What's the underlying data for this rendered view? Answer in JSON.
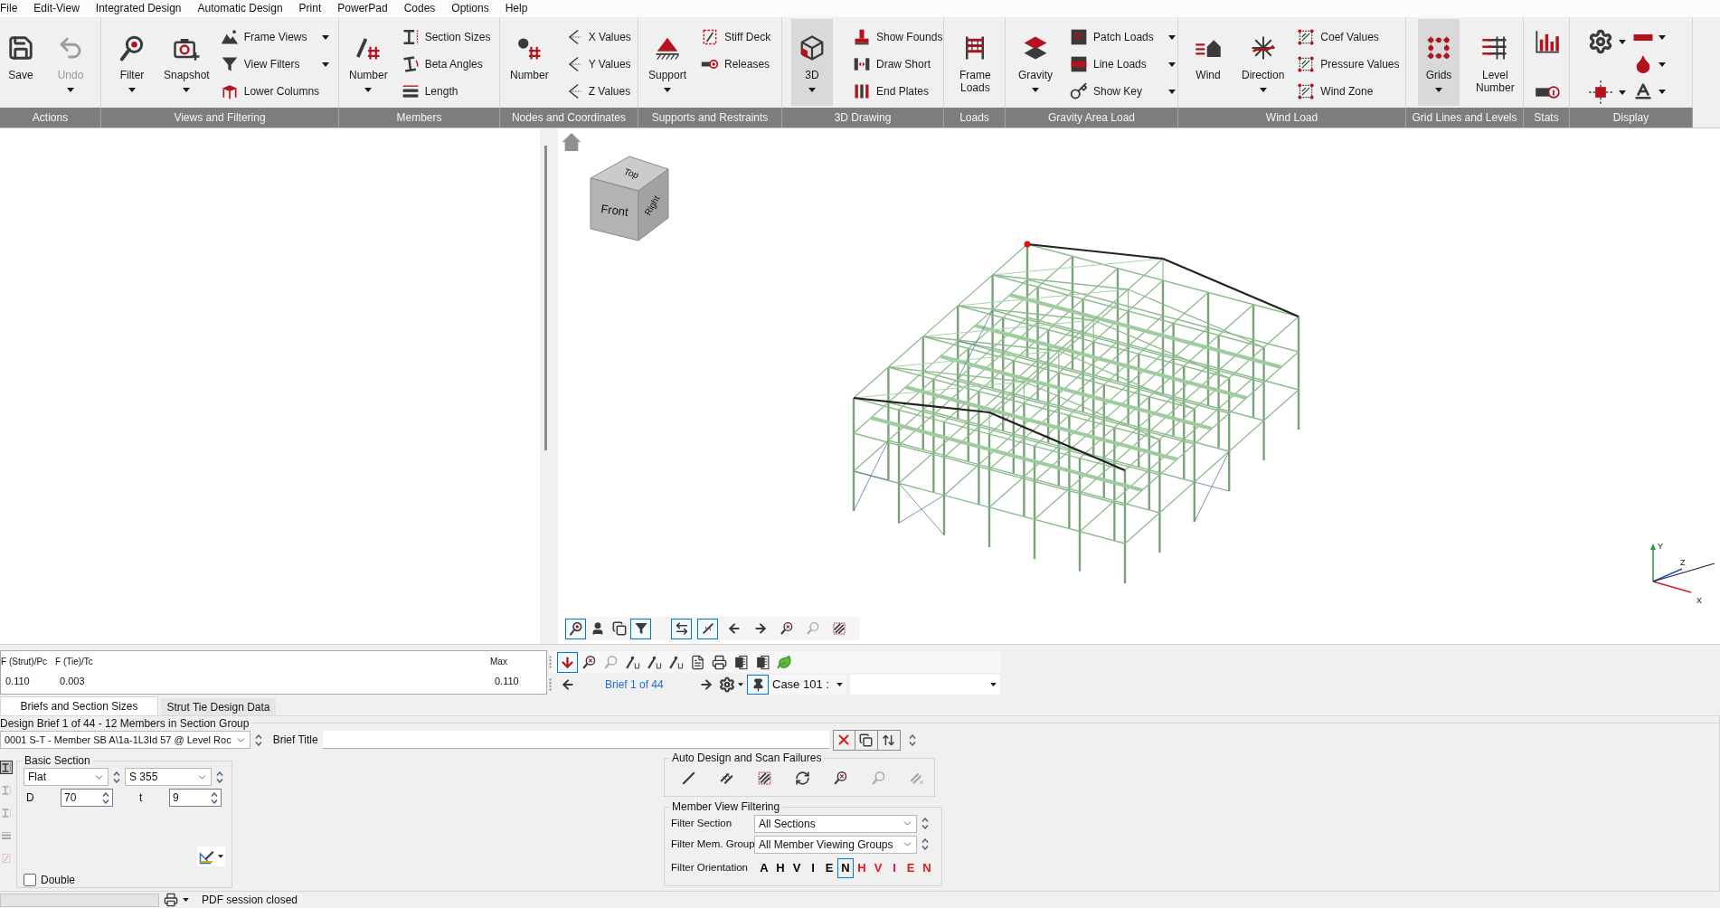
{
  "menu": [
    "File",
    "Edit-View",
    "Integrated Design",
    "Automatic Design",
    "Print",
    "PowerPad",
    "Codes",
    "Options",
    "Help"
  ],
  "ribbon": {
    "groups": [
      {
        "label": "Actions",
        "items": [
          {
            "kind": "large",
            "label": "Save",
            "dropdown": false,
            "selected": false,
            "disabled": false
          },
          {
            "kind": "large",
            "label": "Undo",
            "dropdown": true,
            "selected": false,
            "disabled": true
          }
        ]
      },
      {
        "label": "Views and Filtering",
        "items": [
          {
            "kind": "large",
            "label": "Filter",
            "dropdown": true,
            "selected": false,
            "disabled": false
          },
          {
            "kind": "large",
            "label": "Snapshot",
            "dropdown": true,
            "selected": false,
            "disabled": false
          },
          {
            "kind": "stack",
            "items": [
              {
                "label": "Frame Views",
                "dropdown": true
              },
              {
                "label": "View Filters",
                "dropdown": true
              },
              {
                "label": "Lower Columns",
                "dropdown": false
              }
            ]
          }
        ]
      },
      {
        "label": "Members",
        "items": [
          {
            "kind": "large",
            "label": "Number",
            "dropdown": true,
            "selected": false,
            "disabled": false
          },
          {
            "kind": "stack",
            "items": [
              {
                "label": "Section Sizes",
                "dropdown": false
              },
              {
                "label": "Beta Angles",
                "dropdown": false
              },
              {
                "label": "Length",
                "dropdown": false
              }
            ]
          }
        ]
      },
      {
        "label": "Nodes and Coordinates",
        "items": [
          {
            "kind": "large",
            "label": "Number",
            "dropdown": false,
            "selected": false,
            "disabled": false
          },
          {
            "kind": "stack",
            "items": [
              {
                "label": "X Values",
                "dropdown": false
              },
              {
                "label": "Y Values",
                "dropdown": false
              },
              {
                "label": "Z Values",
                "dropdown": false
              }
            ]
          }
        ]
      },
      {
        "label": "Supports and Restraints",
        "items": [
          {
            "kind": "large",
            "label": "Support",
            "dropdown": true,
            "selected": false,
            "disabled": false
          },
          {
            "kind": "stack",
            "items": [
              {
                "label": "Stiff Deck",
                "dropdown": false
              },
              {
                "label": "Releases",
                "dropdown": false
              }
            ]
          }
        ]
      },
      {
        "label": "3D Drawing",
        "items": [
          {
            "kind": "large",
            "label": "3D",
            "dropdown": true,
            "selected": true,
            "disabled": false
          },
          {
            "kind": "stack",
            "items": [
              {
                "label": "Show Founds",
                "dropdown": false
              },
              {
                "label": "Draw Short",
                "dropdown": false
              },
              {
                "label": "End Plates",
                "dropdown": false
              }
            ]
          }
        ]
      },
      {
        "label": "Loads",
        "items": [
          {
            "kind": "large",
            "label": "Frame Loads",
            "dropdown": false,
            "selected": false,
            "disabled": false
          }
        ]
      },
      {
        "label": "Gravity Area Load",
        "items": [
          {
            "kind": "large",
            "label": "Gravity",
            "dropdown": true,
            "selected": false,
            "disabled": false
          },
          {
            "kind": "stack",
            "items": [
              {
                "label": "Patch Loads",
                "dropdown": true
              },
              {
                "label": "Line Loads",
                "dropdown": true
              },
              {
                "label": "Show Key",
                "dropdown": true
              }
            ]
          }
        ]
      },
      {
        "label": "Wind Load",
        "items": [
          {
            "kind": "large",
            "label": "Wind",
            "dropdown": false,
            "selected": false,
            "disabled": false
          },
          {
            "kind": "large",
            "label": "Direction",
            "dropdown": true,
            "selected": false,
            "disabled": false
          },
          {
            "kind": "stack",
            "items": [
              {
                "label": "Coef Values",
                "dropdown": false
              },
              {
                "label": "Pressure Values",
                "dropdown": false
              },
              {
                "label": "Wind Zone",
                "dropdown": false
              }
            ]
          }
        ]
      },
      {
        "label": "Grid Lines and Levels",
        "items": [
          {
            "kind": "large",
            "label": "Grids",
            "dropdown": true,
            "selected": true,
            "disabled": false
          },
          {
            "kind": "large",
            "label": "Level Number",
            "dropdown": false,
            "selected": false,
            "disabled": false
          }
        ]
      },
      {
        "label": "Stats",
        "items": [
          {
            "kind": "icons",
            "items": [
              {
                "dropdown": false
              },
              {
                "dropdown": false
              }
            ]
          }
        ]
      },
      {
        "label": "Display",
        "items": [
          {
            "kind": "icons",
            "items": [
              {
                "dropdown": true
              },
              {
                "dropdown": true
              }
            ]
          },
          {
            "kind": "icons",
            "items": [
              {
                "dropdown": true
              },
              {
                "dropdown": true
              },
              {
                "dropdown": true
              }
            ]
          }
        ]
      }
    ]
  },
  "viewport": {
    "cube": {
      "top": "Top",
      "front": "Front",
      "right": "Right"
    },
    "axes": {
      "y": "Y",
      "z": "Z",
      "x": "X"
    }
  },
  "view_toolbar": [
    {
      "buttons": [
        {
          "selected": true,
          "disabled": false
        },
        {
          "selected": false,
          "disabled": false
        },
        {
          "selected": false,
          "disabled": false
        },
        {
          "selected": true,
          "disabled": false
        }
      ]
    },
    {
      "buttons": [
        {
          "selected": true,
          "disabled": false
        },
        {
          "selected": true,
          "disabled": false
        },
        {
          "selected": false,
          "disabled": false
        },
        {
          "selected": false,
          "disabled": false
        },
        {
          "selected": false,
          "disabled": false
        },
        {
          "selected": false,
          "disabled": true
        },
        {
          "selected": false,
          "disabled": false
        }
      ]
    }
  ],
  "results": {
    "columns": [
      {
        "label": "F (Strut)/Pc",
        "value": "0.110"
      },
      {
        "label": "F (Tie)/Tc",
        "value": "0.003"
      },
      {
        "label": "Max",
        "value": "0.110"
      }
    ]
  },
  "report_toolbar": [
    {
      "selected": true,
      "disabled": false
    },
    {
      "selected": false,
      "disabled": false
    },
    {
      "selected": false,
      "disabled": true
    },
    {
      "selected": false,
      "disabled": false
    },
    {
      "selected": false,
      "disabled": false
    },
    {
      "selected": false,
      "disabled": false
    },
    {
      "selected": false,
      "disabled": false
    },
    {
      "selected": false,
      "disabled": false
    },
    {
      "selected": false,
      "disabled": false
    },
    {
      "selected": false,
      "disabled": false
    },
    {
      "selected": false,
      "disabled": false
    }
  ],
  "brief_nav": {
    "label": "Brief 1 of 44",
    "pinned": true,
    "case": "Case 101 :"
  },
  "tabs": [
    {
      "label": "Briefs and Section Sizes",
      "selected": true
    },
    {
      "label": "Strut Tie Design Data",
      "selected": false
    }
  ],
  "brief": {
    "heading": "Design Brief 1 of 44 - 12 Members in Section Group",
    "selector": "0001 S-T - Member SB A\\1a-1L3Id 57 @ Level Roc",
    "title_label": "Brief Title"
  },
  "section_tools": [
    {
      "selected": true
    },
    {
      "selected": false
    },
    {
      "selected": false
    },
    {
      "selected": false
    },
    {
      "selected": false
    }
  ],
  "basic_section": {
    "title": "Basic Section",
    "section": "Flat",
    "grade": "S 355",
    "dims": [
      {
        "label": "D",
        "value": "70"
      },
      {
        "label": "t",
        "value": "9"
      }
    ],
    "double": {
      "label": "Double",
      "checked": false
    }
  },
  "auto_design": {
    "title": "Auto Design and Scan Failures",
    "buttons": [
      {
        "disabled": false
      },
      {
        "disabled": false
      },
      {
        "disabled": false
      },
      {
        "disabled": false
      },
      {
        "disabled": false
      },
      {
        "disabled": true
      },
      {
        "disabled": true
      }
    ]
  },
  "member_filter": {
    "title": "Member View Filtering",
    "rows": [
      {
        "label": "Filter Section",
        "value": "All Sections"
      },
      {
        "label": "Filter Mem. Group",
        "value": "All Member Viewing Groups"
      }
    ],
    "orientation": {
      "label": "Filter Orientation",
      "options": [
        {
          "label": "A",
          "selected": false,
          "color": "#000000"
        },
        {
          "label": "H",
          "selected": false,
          "color": "#000000"
        },
        {
          "label": "V",
          "selected": false,
          "color": "#000000"
        },
        {
          "label": "I",
          "selected": false,
          "color": "#000000"
        },
        {
          "label": "E",
          "selected": false,
          "color": "#000000"
        },
        {
          "label": "N",
          "selected": true,
          "color": "#000000"
        },
        {
          "label": "H",
          "selected": false,
          "color": "#e81123"
        },
        {
          "label": "V",
          "selected": false,
          "color": "#e81123"
        },
        {
          "label": "I",
          "selected": false,
          "color": "#e81123"
        },
        {
          "label": "E",
          "selected": false,
          "color": "#e81123"
        },
        {
          "label": "N",
          "selected": false,
          "color": "#e81123"
        }
      ]
    }
  },
  "status_bar": {
    "text": "PDF session closed"
  }
}
